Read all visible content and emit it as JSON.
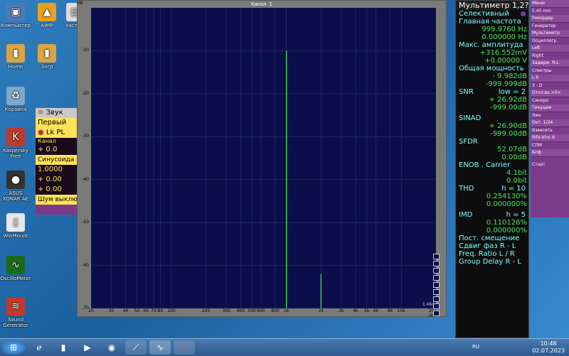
{
  "desktop_icons": [
    {
      "label": "Компьютер",
      "glyph": "▣",
      "color": "#4a7ab8"
    },
    {
      "label": "AIMP",
      "glyph": "▲",
      "color": "#e8a020"
    },
    {
      "label": "насто...",
      "glyph": "▤",
      "color": "#dddddd"
    },
    {
      "label": "Home",
      "glyph": "▮",
      "color": "#d9a441"
    },
    {
      "label": "Загр",
      "glyph": "▮",
      "color": "#d9a441"
    },
    {
      "label": "Корзина",
      "glyph": "♻",
      "color": "#7fa7c8"
    },
    {
      "label": "Kaspersky Free",
      "glyph": "K",
      "color": "#c0392b"
    },
    {
      "label": "ASUS XONAR AE",
      "glyph": "●",
      "color": "#333333"
    },
    {
      "label": "WinMount",
      "glyph": "▯",
      "color": "#e8e8e8"
    },
    {
      "label": "OscilloMeter",
      "glyph": "∿",
      "color": "#1a6a1a"
    },
    {
      "label": "Sound Generator",
      "glyph": "≋",
      "color": "#c0392b"
    }
  ],
  "spectrum": {
    "title": "Канал 1",
    "y_unit": "dB",
    "corner_label": "1.464",
    "y_ticks": [
      "-10",
      "-20",
      "-30",
      "-40",
      "-50",
      "-60",
      "-70"
    ],
    "x_ticks": [
      "20",
      "30",
      "40",
      "50",
      "60",
      "70",
      "80",
      "100",
      "200",
      "300",
      "400",
      "500",
      "600",
      "800",
      "1k",
      "2k",
      "3k",
      "4k",
      "5k",
      "6k",
      "8k",
      "10k",
      "20k Hz"
    ]
  },
  "chart_data": {
    "type": "line",
    "xscale": "log",
    "xlim": [
      20,
      20000
    ],
    "ylim": [
      -70,
      0
    ],
    "ylabel": "dB",
    "grid": true,
    "peaks": [
      {
        "freq": 1000,
        "db": -10
      },
      {
        "freq": 2000,
        "db": -62
      }
    ]
  },
  "multimeter": {
    "title": "Мультиметр 1,2?",
    "mode": "Селективный",
    "main_freq_label": "Главная частота",
    "freq1": "999.9760 Hz",
    "freq2": "0.000000 Hz",
    "max_amp_label": "Макс. амплитуда",
    "amp1": "+316.552mV",
    "amp2": "+0.00000 V",
    "power_label": "Общая мощность",
    "power1": "- 9.982dB",
    "power2": "-999.999dB",
    "snr_label": "SNR",
    "snr_low": "low = 2",
    "snr1": "+ 26.92dB",
    "snr2": "-999.00dB",
    "sinad_label": "SINAD",
    "sinad1": "+ 26.90dB",
    "sinad2": "-999.00dB",
    "sfdr_label": "SFDR",
    "sfdr1": "52.07dB",
    "sfdr2": "0.00dB",
    "enob_label": "ENOB . Carrier",
    "enob1": "4.1bit",
    "enob2": "0.0bit",
    "thd_label": "THD",
    "thd_h": "h = 10",
    "thd1": "0.254130%",
    "thd2": "0.000000%",
    "imd_label": "IMD",
    "imd_h": "h = 5",
    "imd1": "0.110126%",
    "imd2": "0.000000%",
    "dc_label": "Пост. смещение",
    "phase_label": "Сдвиг фаз R - L",
    "ratio_label": "Freq. Ratio L / R",
    "delay_label": "Group Delay R - L"
  },
  "control": {
    "items": [
      "Меню",
      "5.45 mm",
      "Рекордер",
      "Генератор",
      "Мультиметр",
      "Осциллогр",
      "Left",
      "Right",
      "Задерж. R-L",
      "Спектры",
      "L R",
      "3 - D",
      "Откл.вх.>0<",
      "Синхро",
      "Текущее",
      "Лин",
      "Окт. 1/24",
      "Взвесить",
      "Rife-Vinc 6",
      "СПМ",
      "Бпф",
      "Старт"
    ]
  },
  "generator": {
    "title": "Звук",
    "preset": "Первый",
    "lk": "Lk PL",
    "channel": "Канал",
    "val1": "+ 0.0",
    "wave": "Синусоида",
    "val2": "1.0000",
    "val3": "+ 0.00",
    "val4": "+ 0.00",
    "noise": "Шум выклю"
  },
  "taskbar": {
    "lang": "RU",
    "time": "10:48",
    "date": "02.07.2023"
  }
}
